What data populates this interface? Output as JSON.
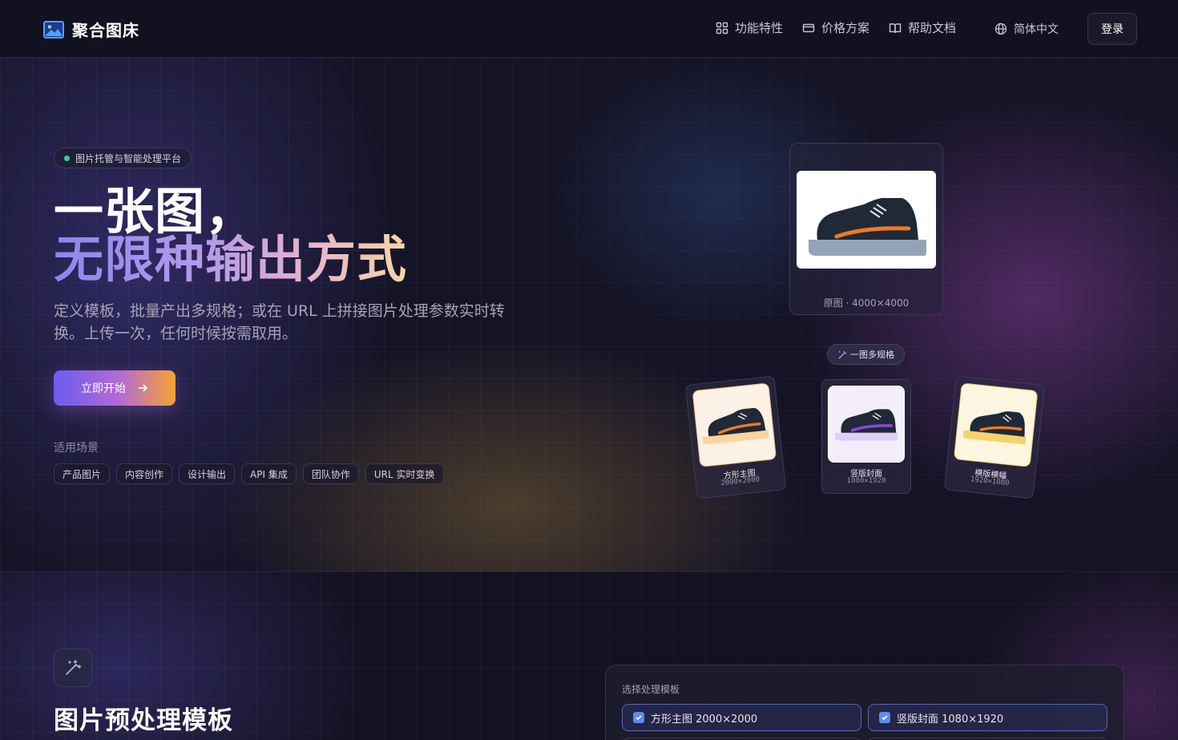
{
  "nav": {
    "brand": "聚合图床",
    "links": [
      {
        "label": "功能特性",
        "icon": "grid-icon"
      },
      {
        "label": "价格方案",
        "icon": "card-icon"
      },
      {
        "label": "帮助文档",
        "icon": "book-icon"
      }
    ],
    "language": "简体中文",
    "login": "登录"
  },
  "hero": {
    "badge": "图片托管与智能处理平台",
    "headline_line1": "一张图，",
    "headline_line2": "无限种输出方式",
    "subtitle": "定义模板，批量产出多规格；或在 URL 上拼接图片处理参数实时转换。上传一次，任何时候按需取用。",
    "cta": "立即开始",
    "scenes_label": "适用场景",
    "tags": [
      "产品图片",
      "内容创作",
      "设计输出",
      "API 集成",
      "团队协作",
      "URL 实时变换"
    ],
    "original_caption": "原图 · 4000×4000",
    "multi_label": "一图多规格",
    "variants": [
      {
        "label": "方形主图",
        "size": "2000×2000",
        "accent": "#f07b1e"
      },
      {
        "label": "竖版封面",
        "size": "1080×1920",
        "accent": "#8b4ad6"
      },
      {
        "label": "横版横幅",
        "size": "1920×1080",
        "accent": "#f07b1e"
      }
    ]
  },
  "section2": {
    "title": "图片预处理模板",
    "panel_label": "选择处理模板",
    "options": [
      "方形主图 2000×2000",
      "竖版封面 1080×1920"
    ]
  },
  "colors": {
    "accent_purple": "#6b5cf0",
    "accent_orange": "#f6a331",
    "status_green": "#34d399",
    "checkbox_blue": "#5b8dee"
  }
}
